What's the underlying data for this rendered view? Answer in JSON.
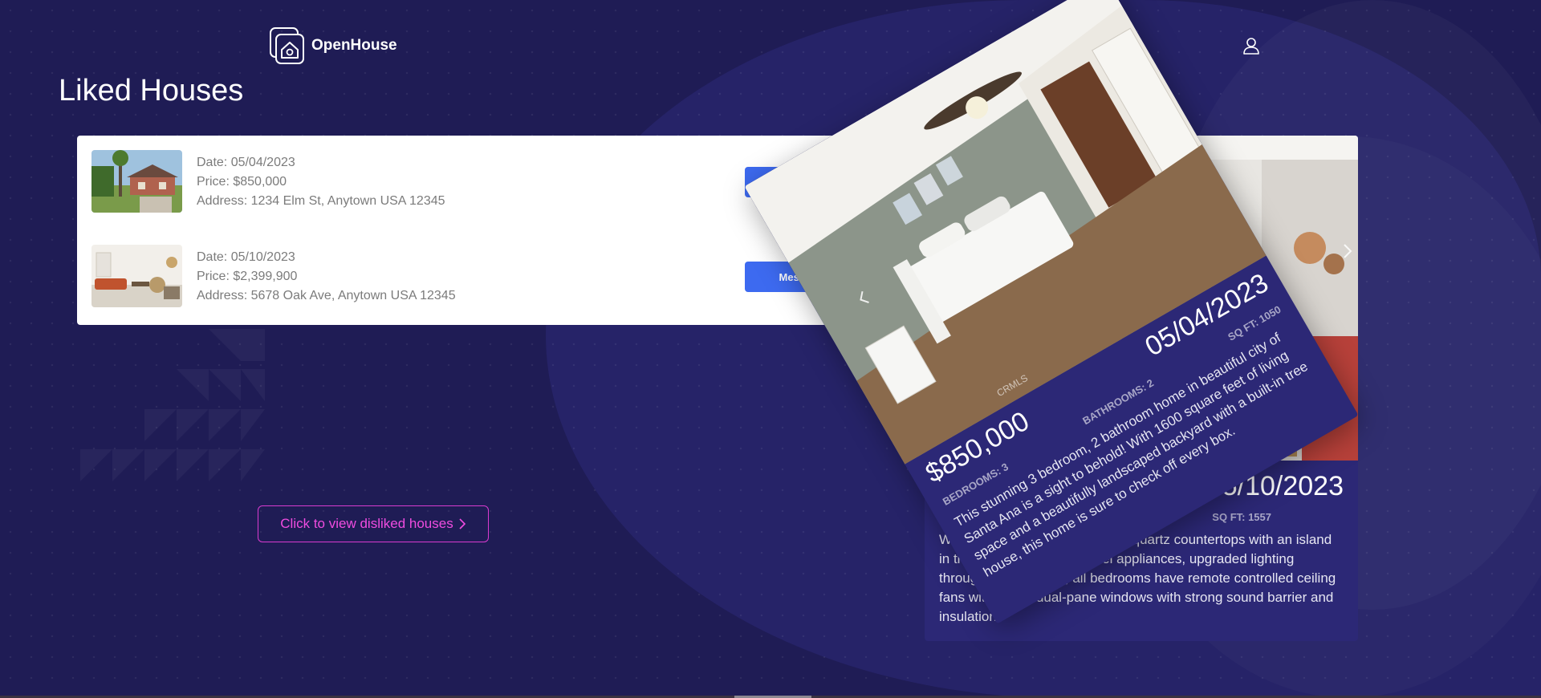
{
  "header": {
    "brand": "OpenHouse"
  },
  "page": {
    "title": "Liked Houses"
  },
  "houses": [
    {
      "date": "Date: 05/04/2023",
      "price": "Price: $850,000",
      "address": "Address: 1234 Elm St, Anytown USA 12345",
      "action": "Message"
    },
    {
      "date": "Date: 05/10/2023",
      "price": "Price: $2,399,900",
      "address": "Address: 5678 Oak Ave, Anytown USA 12345",
      "action": "Message"
    }
  ],
  "dislike_link": {
    "label": "Click to view disliked houses"
  },
  "front_card": {
    "price": "$850,000",
    "date": "05/04/2023",
    "bedrooms": "BEDROOMS: 3",
    "bathrooms": "BATHROOMS: 2",
    "sqft": "SQ FT: 1050",
    "watermark": "CRMLS",
    "description": "This stunning 3 bedroom, 2 bathroom home in beautiful city of Santa Ana is a sight to behold! With 1600 square feet of living space and a beautifully landscaped backyard with a built-in tree house, this home is sure to check off every box."
  },
  "back_card": {
    "date": "05/10/2023",
    "sqft": "SQ FT: 1557",
    "description": "Wood floors in the entire home, quartz countertops with an island in the kitchen, stainless steel appliances, upgraded lighting throughout the home, all bedrooms have remote controlled ceiling fans with lights, dual-pane windows with strong sound barrier and insulation."
  },
  "colors": {
    "background": "#1f1c55",
    "card": "#2c2876",
    "message_button": "#3d6af0",
    "dislike_accent": "#f04ce0"
  },
  "icons": {
    "logo": "house-in-frame-icon",
    "user": "user-icon",
    "prev": "chevron-left-icon",
    "next": "chevron-right-icon"
  }
}
